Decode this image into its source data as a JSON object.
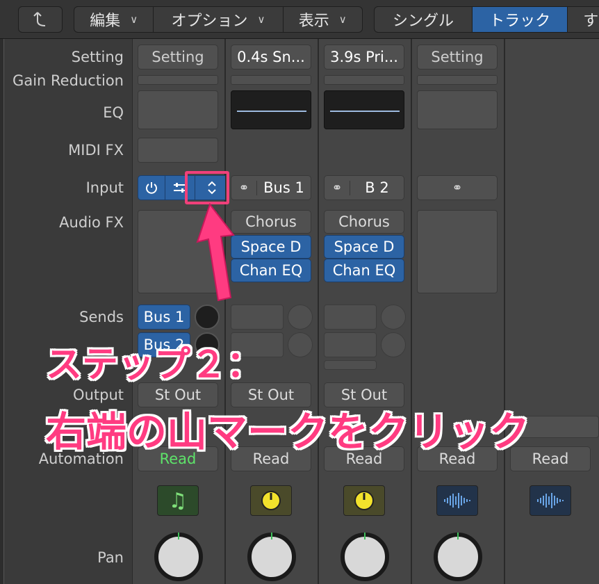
{
  "toolbar": {
    "back_icon": "arrow-up-left-icon",
    "menus": [
      {
        "label": "編集"
      },
      {
        "label": "オプション"
      },
      {
        "label": "表示"
      }
    ],
    "view_tabs": [
      {
        "label": "シングル",
        "active": false
      },
      {
        "label": "トラック",
        "active": true
      },
      {
        "label": "す",
        "active": false
      }
    ]
  },
  "row_labels": {
    "setting": "Setting",
    "gain_reduction": "Gain Reduction",
    "eq": "EQ",
    "midi_fx": "MIDI FX",
    "input": "Input",
    "audio_fx": "Audio FX",
    "sends": "Sends",
    "output": "Output",
    "automation": "Automation",
    "pan": "Pan"
  },
  "strips": [
    {
      "setting": "Setting",
      "input": "",
      "fx": [],
      "sends": [
        "Bus 1",
        "Bus 2"
      ],
      "output": "St Out",
      "automation": "Read",
      "icon": "music-note-icon"
    },
    {
      "setting": "0.4s Sn...",
      "input": "Bus 1",
      "fx": [
        "Chorus",
        "Space D",
        "Chan EQ"
      ],
      "sends": [],
      "output": "St Out",
      "automation": "Read",
      "icon": "yellow-knob-icon"
    },
    {
      "setting": "3.9s Pri...",
      "input": "B 2",
      "fx": [
        "Chorus",
        "Space D",
        "Chan EQ"
      ],
      "sends": [],
      "output": "St Out",
      "automation": "Read",
      "icon": "yellow-knob-icon"
    },
    {
      "setting": "Setting",
      "input": "",
      "fx": [],
      "sends": [],
      "output": "",
      "automation": "Read",
      "icon": "waveform-icon"
    },
    {
      "setting": "",
      "input": "",
      "fx": [],
      "sends": [],
      "output": "",
      "automation": "Read",
      "icon": "waveform-icon"
    }
  ],
  "annotation": {
    "line1": "ステップ２：",
    "line2": "右端の山マークをクリック"
  },
  "colors": {
    "accent_blue": "#2c63a4",
    "highlight_pink": "#f0407a",
    "read_green": "#5ee36a"
  }
}
